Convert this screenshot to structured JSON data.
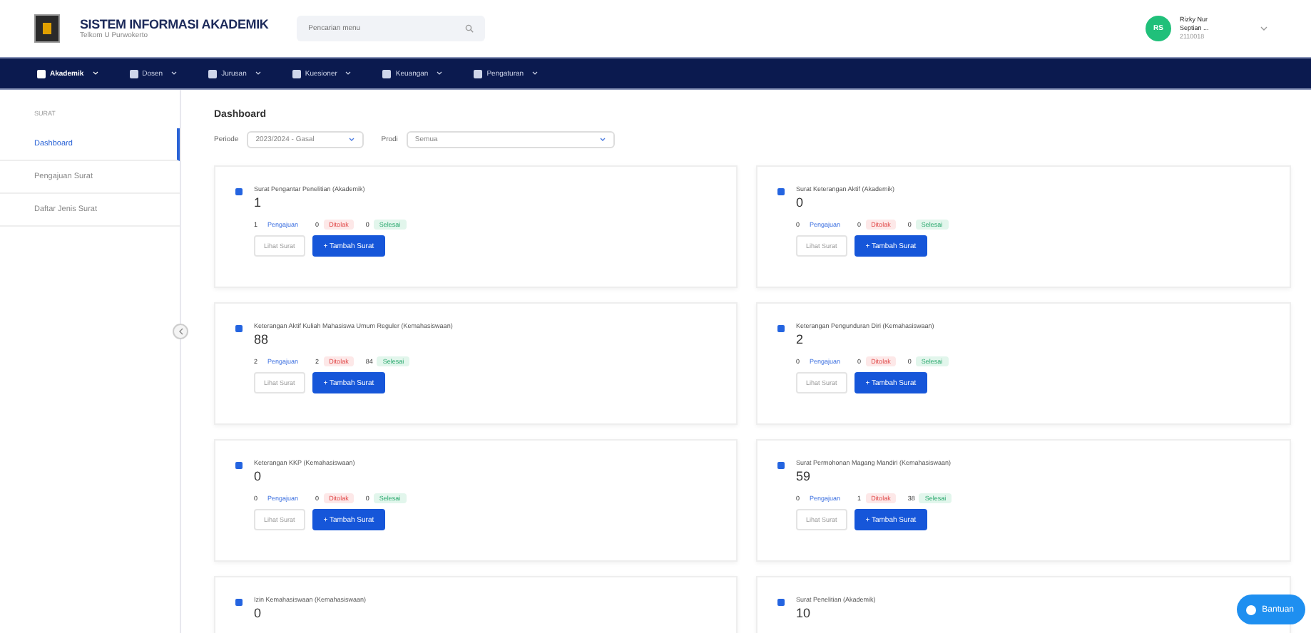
{
  "header": {
    "title": "SISTEM INFORMASI AKADEMIK",
    "subtitle": "Telkom U Purwokerto",
    "search": {
      "placeholder": "Pencarian menu"
    },
    "user": {
      "initials": "RS",
      "name": "Rizky Nur",
      "name_2": "Septian ...",
      "id": "2110018"
    }
  },
  "nav": [
    {
      "label": "Akademik",
      "selected": true
    },
    {
      "label": "Dosen",
      "selected": false
    },
    {
      "label": "Jurusan",
      "selected": false
    },
    {
      "label": "Kuesioner",
      "selected": false
    },
    {
      "label": "Keuangan",
      "selected": false
    },
    {
      "label": "Pengaturan",
      "selected": false
    }
  ],
  "sidebar": {
    "heading": "SURAT",
    "items": [
      {
        "label": "Dashboard",
        "selected": true
      },
      {
        "label": "Pengajuan Surat",
        "selected": false
      },
      {
        "label": "Daftar Jenis Surat",
        "selected": false
      }
    ]
  },
  "page_title": "Dashboard",
  "filters": [
    {
      "label": "Periode",
      "value": "2023/2024 - Gasal"
    },
    {
      "label": "Prodi",
      "value": "Semua"
    }
  ],
  "cards": [
    {
      "title": "Surat Pengantar Penelitian (Akademik)",
      "count": "1",
      "stats": [
        {
          "value": "1",
          "label": "Pengajuan",
          "kind": "pending"
        },
        {
          "value": "0",
          "label": "Ditolak",
          "kind": "rejected"
        },
        {
          "value": "0",
          "label": "Selesai",
          "kind": "done"
        }
      ]
    },
    {
      "title": "Surat Keterangan Aktif (Akademik)",
      "count": "0",
      "stats": [
        {
          "value": "0",
          "label": "Pengajuan",
          "kind": "pending"
        },
        {
          "value": "0",
          "label": "Ditolak",
          "kind": "rejected"
        },
        {
          "value": "0",
          "label": "Selesai",
          "kind": "done"
        }
      ]
    },
    {
      "title": "Keterangan Aktif Kuliah Mahasiswa Umum Reguler (Kemahasiswaan)",
      "count": "88",
      "stats": [
        {
          "value": "2",
          "label": "Pengajuan",
          "kind": "pending"
        },
        {
          "value": "2",
          "label": "Ditolak",
          "kind": "rejected"
        },
        {
          "value": "84",
          "label": "Selesai",
          "kind": "done"
        }
      ]
    },
    {
      "title": "Keterangan Pengunduran Diri (Kemahasiswaan)",
      "count": "2",
      "stats": [
        {
          "value": "0",
          "label": "Pengajuan",
          "kind": "pending"
        },
        {
          "value": "0",
          "label": "Ditolak",
          "kind": "rejected"
        },
        {
          "value": "0",
          "label": "Selesai",
          "kind": "done"
        }
      ]
    },
    {
      "title": "Keterangan KKP (Kemahasiswaan)",
      "count": "0",
      "stats": [
        {
          "value": "0",
          "label": "Pengajuan",
          "kind": "pending"
        },
        {
          "value": "0",
          "label": "Ditolak",
          "kind": "rejected"
        },
        {
          "value": "0",
          "label": "Selesai",
          "kind": "done"
        }
      ]
    },
    {
      "title": "Surat Permohonan Magang Mandiri (Kemahasiswaan)",
      "count": "59",
      "stats": [
        {
          "value": "0",
          "label": "Pengajuan",
          "kind": "pending"
        },
        {
          "value": "1",
          "label": "Ditolak",
          "kind": "rejected"
        },
        {
          "value": "38",
          "label": "Selesai",
          "kind": "done"
        }
      ]
    },
    {
      "title": "Izin Kemahasiswaan (Kemahasiswaan)",
      "count": "0"
    },
    {
      "title": "Surat Penelitian (Akademik)",
      "count": "10"
    }
  ],
  "buttons": [
    {
      "view": "Lihat Surat",
      "add": "+ Tambah Surat"
    },
    {
      "view": "Lihat Surat",
      "add": "+ Tambah Surat"
    },
    {
      "view": "Lihat Surat",
      "add": "+ Tambah Surat"
    },
    {
      "view": "Lihat Surat",
      "add": "+ Tambah Surat"
    },
    {
      "view": "Lihat Surat",
      "add": "+ Tambah Surat"
    },
    {
      "view": "Lihat Surat",
      "add": "+ Tambah Surat"
    }
  ],
  "help": {
    "label": "Bantuan"
  }
}
